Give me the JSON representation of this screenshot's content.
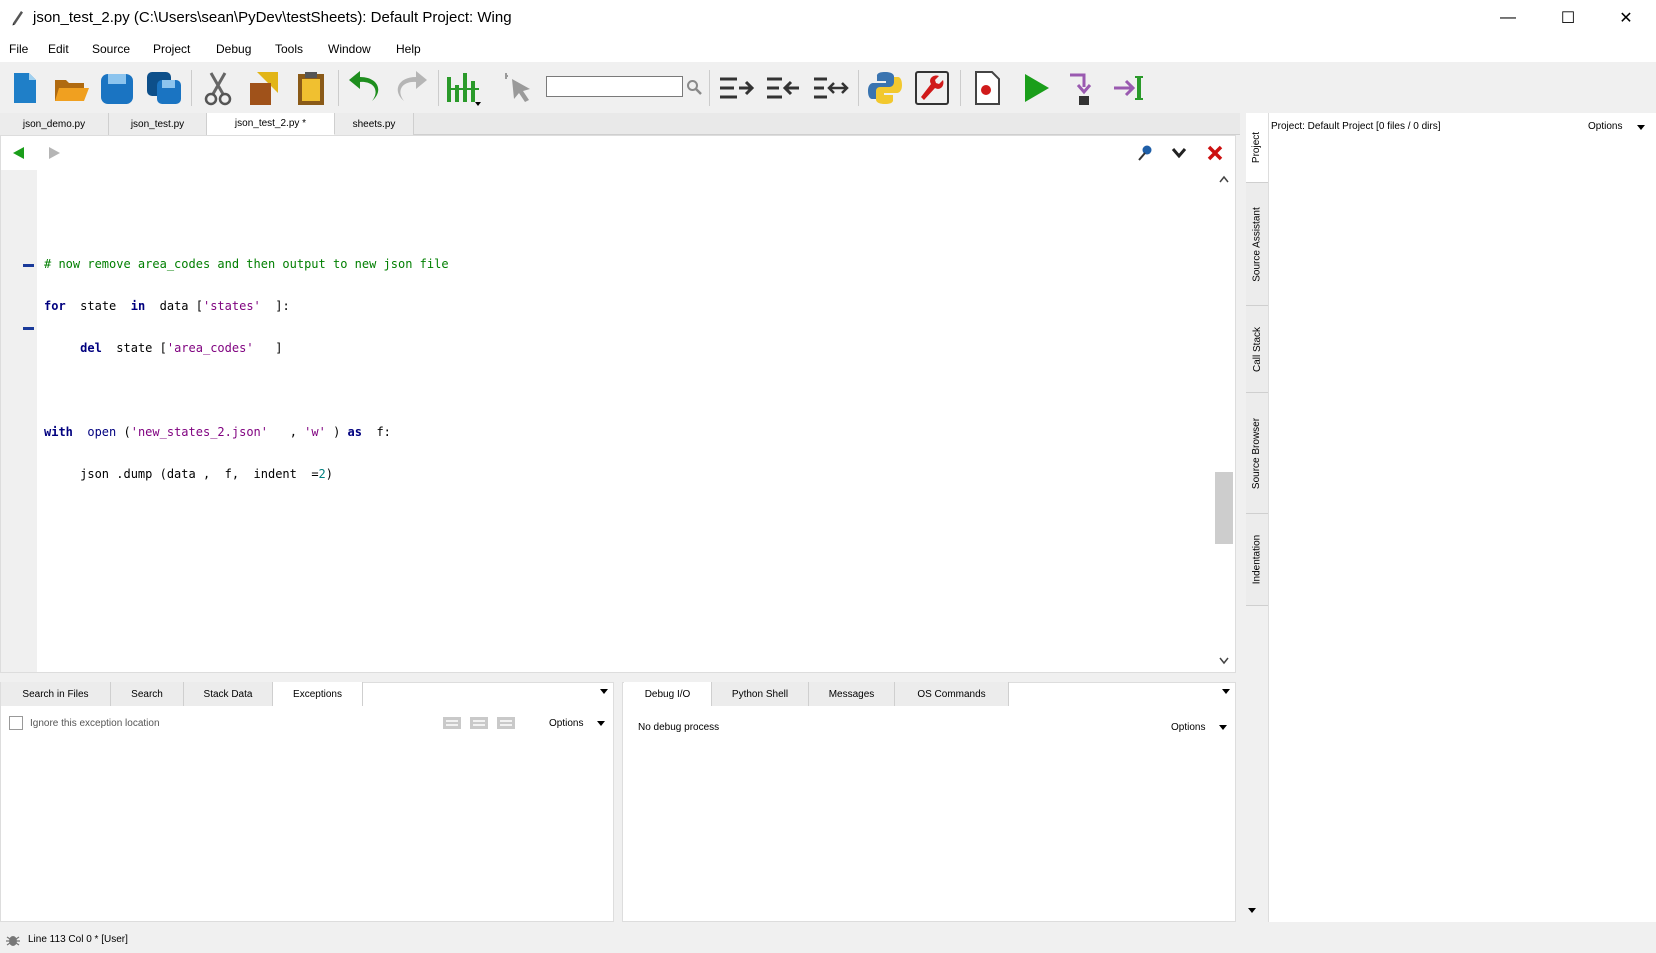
{
  "window": {
    "title": "json_test_2.py (C:\\Users\\sean\\PyDev\\testSheets): Default Project: Wing",
    "minimize": "—",
    "maximize": "☐",
    "close": "✕"
  },
  "menu": [
    "File",
    "Edit",
    "Source",
    "Project",
    "Debug",
    "Tools",
    "Window",
    "Help"
  ],
  "toolbar": {
    "search_value": "",
    "icons": [
      "new-file-icon",
      "open-file-icon",
      "save-icon",
      "save-all-icon",
      "cut-icon",
      "copy-icon",
      "paste-icon",
      "undo-icon",
      "redo-icon",
      "indent-guide-icon",
      "select-icon",
      "search-icon",
      "indent-icon",
      "outdent-icon",
      "indent-toggle-icon",
      "python-icon",
      "debug-settings-icon",
      "breakpoint-icon",
      "run-icon",
      "step-into-icon",
      "step-over-icon"
    ]
  },
  "editor": {
    "tabs": [
      "json_demo.py",
      "json_test.py",
      "json_test_2.py *",
      "sheets.py"
    ],
    "active_tab": "json_test_2.py *",
    "code": {
      "comment": "# now remove area_codes and then output to new json file",
      "l1": {
        "kw": "for",
        "a": "state",
        "kw2": "in",
        "b": "data [",
        "str": "'states'",
        "c": "  ]:"
      },
      "l2": {
        "kw": "del",
        "a": "state [",
        "str": "'area_codes'",
        "c": "   ]"
      },
      "l3": {
        "kw": "with",
        "fn": "open",
        "a": "(",
        "str": "'new_states_2.json'",
        "b": "   ,",
        "str2": "'w'",
        "c": ")",
        "kw2": "as",
        "d": "f:"
      },
      "l4": {
        "a": "json .dump (data ,  f,  indent  =",
        "num": "2",
        "b": ")"
      }
    }
  },
  "bottom_left": {
    "tabs": [
      "Search in Files",
      "Search",
      "Stack Data",
      "Exceptions"
    ],
    "active_tab": "Exceptions",
    "ignore_label": "Ignore this exception location",
    "options": "Options"
  },
  "bottom_right": {
    "tabs": [
      "Debug I/O",
      "Python Shell",
      "Messages",
      "OS Commands"
    ],
    "active_tab": "Debug I/O",
    "status": "No debug process",
    "options": "Options"
  },
  "side_tabs": [
    "Project",
    "Source Assistant",
    "Call Stack",
    "Source Browser",
    "Indentation"
  ],
  "project": {
    "header": "Project: Default Project [0 files / 0 dirs]",
    "options": "Options"
  },
  "status": {
    "text": "Line 113 Col 0 * [User]"
  },
  "colors": {
    "comment": "#007f00",
    "keyword": "#00007f",
    "string": "#7f007f",
    "run_green": "#1a9e1a",
    "close_red": "#cc1111"
  }
}
